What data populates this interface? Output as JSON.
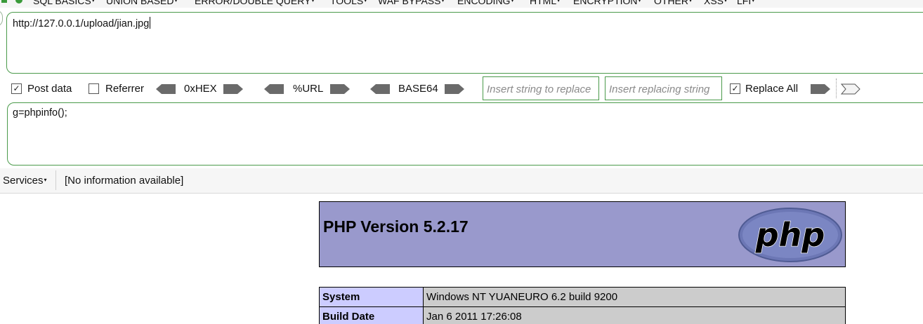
{
  "menu": {
    "items": [
      "SQL BASICS",
      "UNION BASED",
      "ERROR/DOUBLE QUERY",
      "TOOLS",
      "WAF BYPASS",
      "ENCODING",
      "HTML",
      "ENCRYPTION",
      "OTHER",
      "XSS",
      "LFI"
    ]
  },
  "url": {
    "value": "http://127.0.0.1/upload/jian.jpg"
  },
  "toolbar": {
    "post_data_label": "Post data",
    "post_data_checked": true,
    "referrer_label": "Referrer",
    "referrer_checked": false,
    "hex_label": "0xHEX",
    "url_label": "%URL",
    "base64_label": "BASE64",
    "replace_placeholder": "Insert string to replace",
    "replacing_placeholder": "Insert replacing string",
    "replace_all_label": "Replace All",
    "replace_all_checked": true
  },
  "post": {
    "value": "g=phpinfo();"
  },
  "status": {
    "services_label": "Services",
    "info_text": "[No information available]"
  },
  "php": {
    "title": "PHP Version 5.2.17",
    "logo_text": "php",
    "rows": [
      {
        "key": "System",
        "value": "Windows NT YUANEURO 6.2 build 9200"
      },
      {
        "key": "Build Date",
        "value": "Jan 6 2011 17:26:08"
      }
    ]
  },
  "colors": {
    "header_bg": "#9999cc",
    "key_bg": "#ccccff",
    "value_bg": "#cccccc",
    "accent_green": "#4a9a4a"
  }
}
